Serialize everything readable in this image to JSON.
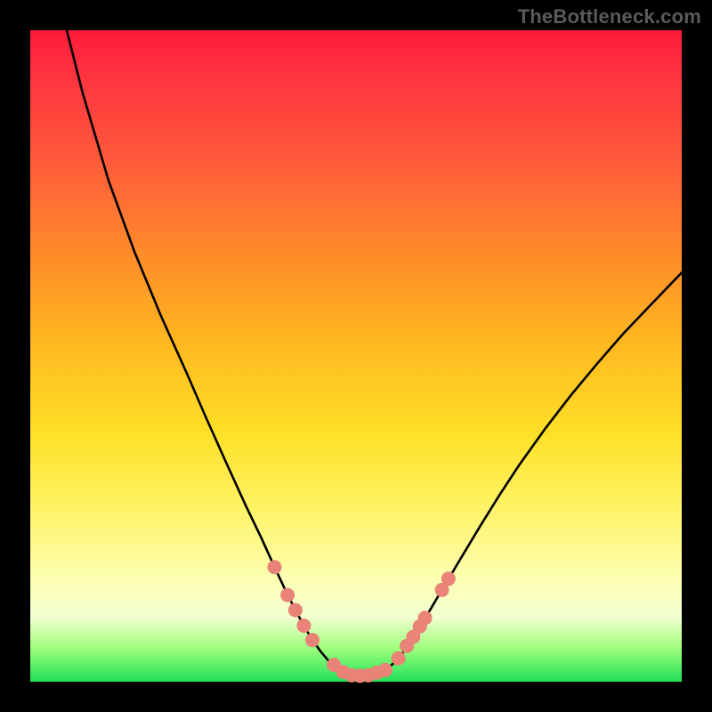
{
  "watermark": "TheBottleneck.com",
  "colors": {
    "frame": "#000000",
    "curve": "#000000",
    "marker_fill": "#e98378",
    "marker_stroke": "#d46a60"
  },
  "chart_data": {
    "type": "line",
    "title": "",
    "xlabel": "",
    "ylabel": "",
    "xlim": [
      0,
      100
    ],
    "ylim": [
      0,
      100
    ],
    "grid": false,
    "series": [
      {
        "name": "left_branch",
        "x": [
          5.6,
          8,
          12,
          16,
          20,
          24,
          27,
          30,
          33,
          35.5,
          37.5,
          39.2,
          40.7,
          42,
          43.3,
          44.6,
          45.8,
          47.0
        ],
        "values": [
          100,
          90.5,
          77.0,
          66.0,
          56.3,
          47.4,
          40.5,
          33.8,
          27.2,
          22.0,
          17.6,
          14.0,
          11.0,
          8.6,
          6.4,
          4.6,
          3.2,
          2.2
        ]
      },
      {
        "name": "valley_floor",
        "x": [
          47.0,
          48.5,
          50.0,
          51.5,
          53.0,
          54.5,
          55.5
        ],
        "values": [
          2.2,
          1.2,
          0.9,
          0.9,
          1.2,
          1.8,
          2.6
        ]
      },
      {
        "name": "right_branch",
        "x": [
          55.5,
          57,
          59,
          61,
          63.5,
          66,
          69,
          72,
          75,
          79,
          83,
          87,
          91,
          95,
          100
        ],
        "values": [
          2.6,
          4.2,
          7.2,
          10.4,
          14.6,
          18.8,
          23.8,
          28.6,
          33.2,
          38.8,
          44.0,
          48.8,
          53.4,
          57.6,
          62.8
        ]
      }
    ],
    "markers": [
      {
        "x": 37.5,
        "y": 17.6
      },
      {
        "x": 39.5,
        "y": 13.3
      },
      {
        "x": 40.7,
        "y": 11.0
      },
      {
        "x": 42.0,
        "y": 8.6
      },
      {
        "x": 43.3,
        "y": 6.4
      },
      {
        "x": 46.6,
        "y": 2.6
      },
      {
        "x": 48.0,
        "y": 1.5
      },
      {
        "x": 49.3,
        "y": 1.0
      },
      {
        "x": 50.6,
        "y": 0.9
      },
      {
        "x": 51.9,
        "y": 1.0
      },
      {
        "x": 53.2,
        "y": 1.4
      },
      {
        "x": 54.5,
        "y": 1.8
      },
      {
        "x": 56.5,
        "y": 3.6
      },
      {
        "x": 57.8,
        "y": 5.5
      },
      {
        "x": 58.8,
        "y": 6.9
      },
      {
        "x": 59.8,
        "y": 8.5
      },
      {
        "x": 60.6,
        "y": 9.8
      },
      {
        "x": 63.2,
        "y": 14.1
      },
      {
        "x": 64.2,
        "y": 15.8
      }
    ]
  }
}
